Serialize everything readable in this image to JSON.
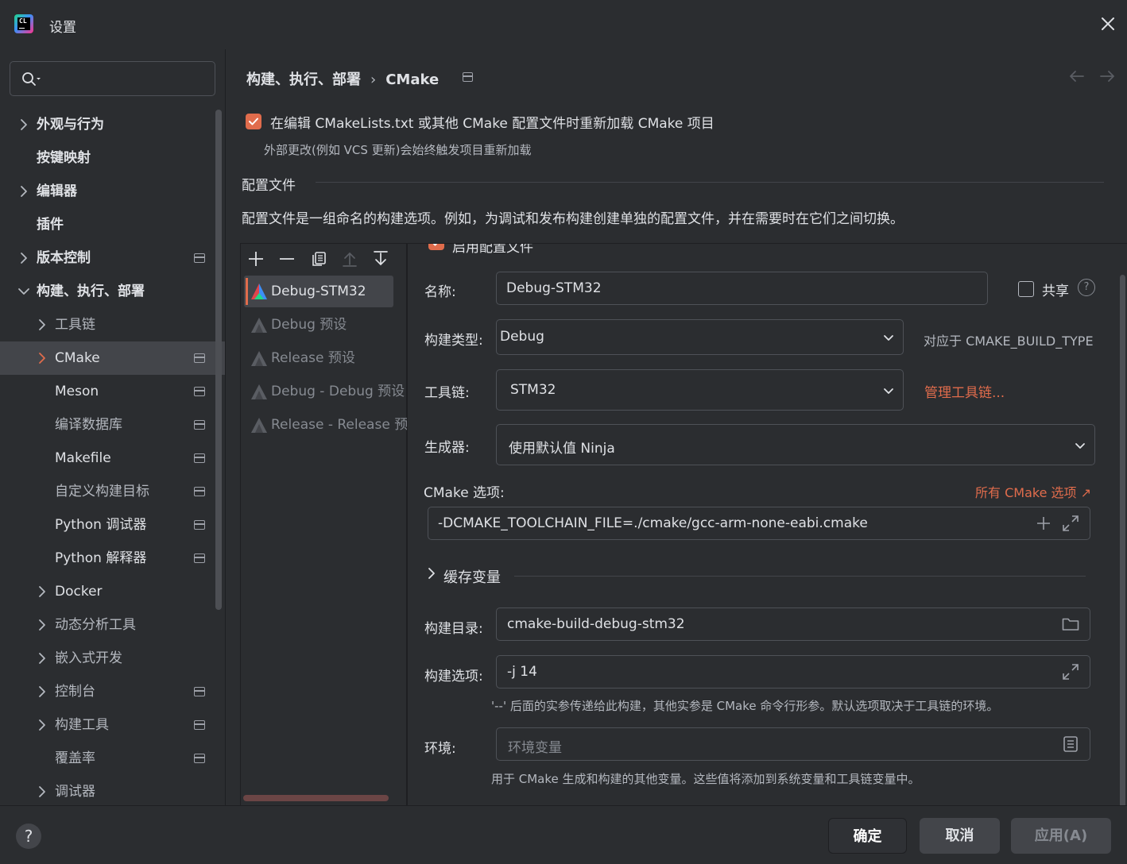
{
  "window": {
    "title": "设置",
    "logo_text": "CL"
  },
  "search": {
    "placeholder": ""
  },
  "tree": [
    {
      "label": "外观与行为",
      "chevron": "right"
    },
    {
      "label": "按键映射"
    },
    {
      "label": "编辑器",
      "chevron": "right"
    },
    {
      "label": "插件"
    },
    {
      "label": "版本控制",
      "chevron": "right",
      "modified": true
    },
    {
      "label": "构建、执行、部署",
      "chevron": "down"
    },
    {
      "label": "工具链",
      "chevron": "right"
    },
    {
      "label": "CMake",
      "chevron": "right",
      "modified": true,
      "selected": true
    },
    {
      "label": "Meson",
      "modified": true
    },
    {
      "label": "编译数据库",
      "modified": true
    },
    {
      "label": "Makefile",
      "modified": true
    },
    {
      "label": "自定义构建目标",
      "modified": true
    },
    {
      "label": "Python 调试器",
      "modified": true
    },
    {
      "label": "Python 解释器",
      "modified": true
    },
    {
      "label": "Docker",
      "chevron": "right"
    },
    {
      "label": "动态分析工具",
      "chevron": "right"
    },
    {
      "label": "嵌入式开发",
      "chevron": "right"
    },
    {
      "label": "控制台",
      "chevron": "right",
      "modified": true
    },
    {
      "label": "构建工具",
      "chevron": "right",
      "modified": true
    },
    {
      "label": "覆盖率",
      "modified": true
    },
    {
      "label": "调试器",
      "chevron": "right"
    }
  ],
  "breadcrumb": {
    "parent": "构建、执行、部署",
    "separator": "›",
    "current": "CMake"
  },
  "reload": {
    "label": "在编辑 CMakeLists.txt 或其他 CMake 配置文件时重新加载 CMake 项目",
    "checked": true,
    "hint": "外部更改(例如 VCS 更新)会始终触发项目重新加载"
  },
  "profiles_section": {
    "title": "配置文件",
    "description": "配置文件是一组命名的构建选项。例如，为调试和发布构建创建单独的配置文件，并在需要时在它们之间切换。"
  },
  "profiles": [
    {
      "name": "Debug-STM32",
      "selected": true
    },
    {
      "name": "Debug 预设",
      "selected": false
    },
    {
      "name": "Release 预设",
      "selected": false
    },
    {
      "name": "Debug - Debug 预设",
      "selected": false
    },
    {
      "name": "Release - Release 预",
      "selected": false
    }
  ],
  "detail": {
    "enable_label": "启用配置文件",
    "name_label": "名称:",
    "name_value": "Debug-STM32",
    "share_label": "共享",
    "help_glyph": "?",
    "build_type_label": "构建类型:",
    "build_type_value": "Debug",
    "build_type_hint": "对应于 CMAKE_BUILD_TYPE",
    "toolchain_label": "工具链:",
    "toolchain_value": "STM32",
    "manage_toolchains": "管理工具链...",
    "generator_label": "生成器:",
    "generator_value": "使用默认值  Ninja",
    "cmake_options_label": "CMake 选项:",
    "all_cmake_options": "所有 CMake 选项 ↗",
    "cmake_options_value": "-DCMAKE_TOOLCHAIN_FILE=./cmake/gcc-arm-none-eabi.cmake",
    "cache_vars_label": "缓存变量",
    "build_dir_label": "构建目录:",
    "build_dir_value": "cmake-build-debug-stm32",
    "build_options_label": "构建选项:",
    "build_options_value": "-j 14",
    "build_options_hint": "'--' 后面的实参传递给此构建，其他实参是 CMake 命令行形参。默认选项取决于工具链的环境。",
    "env_label": "环境:",
    "env_placeholder": "环境变量",
    "env_hint": "用于 CMake 生成和构建的其他变量。这些值将添加到系统变量和工具链变量中。"
  },
  "buttons": {
    "ok": "确定",
    "cancel": "取消",
    "apply": "应用(A)",
    "help": "?"
  },
  "colors": {
    "accent": "#e06c4c",
    "background": "#2b2d30",
    "selection": "#43454a",
    "text": "#dfe1e5"
  }
}
